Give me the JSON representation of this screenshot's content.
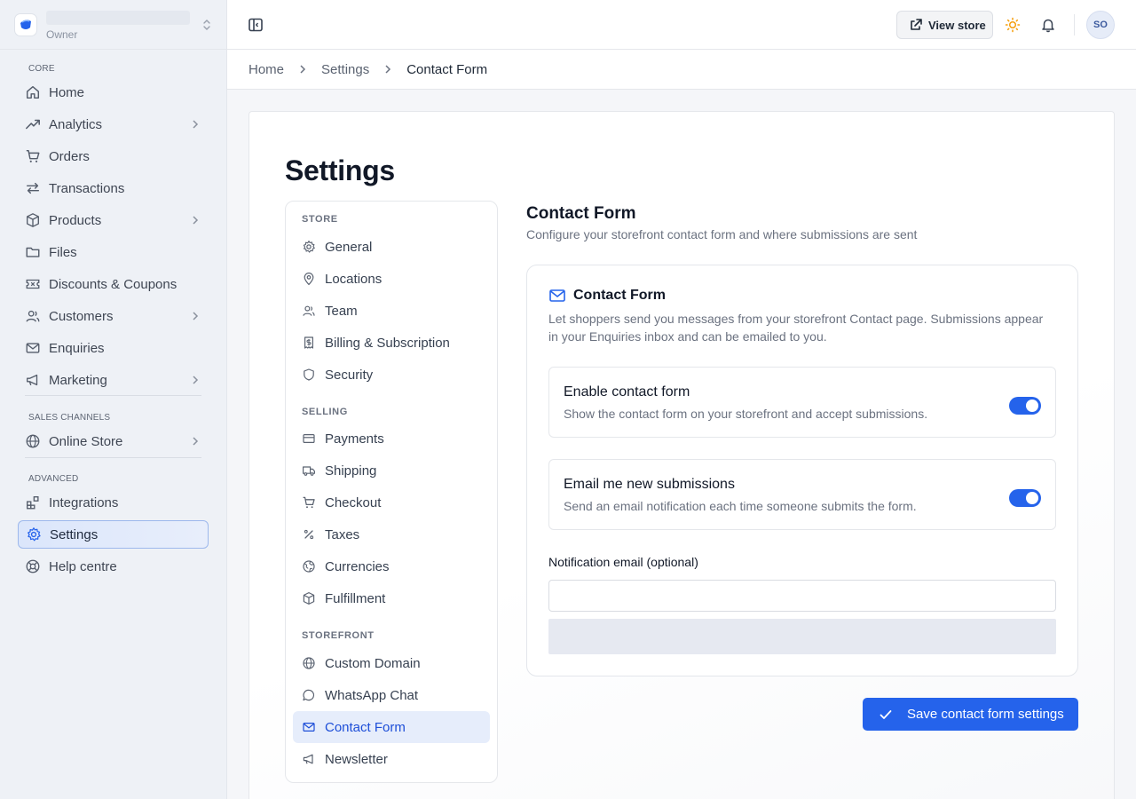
{
  "store": {
    "role": "Owner"
  },
  "sidebar": {
    "sections": [
      "CORE",
      "SALES CHANNELS",
      "ADVANCED"
    ],
    "core": [
      {
        "label": "Home",
        "icon": "home-icon",
        "chevron": false
      },
      {
        "label": "Analytics",
        "icon": "analytics-icon",
        "chevron": true
      },
      {
        "label": "Orders",
        "icon": "cart-icon",
        "chevron": false
      },
      {
        "label": "Transactions",
        "icon": "transfer-icon",
        "chevron": false
      },
      {
        "label": "Products",
        "icon": "box-icon",
        "chevron": true
      },
      {
        "label": "Files",
        "icon": "folder-icon",
        "chevron": false
      },
      {
        "label": "Discounts & Coupons",
        "icon": "ticket-icon",
        "chevron": false
      },
      {
        "label": "Customers",
        "icon": "users-icon",
        "chevron": true
      },
      {
        "label": "Enquiries",
        "icon": "mail-icon",
        "chevron": false
      },
      {
        "label": "Marketing",
        "icon": "megaphone-icon",
        "chevron": true
      }
    ],
    "sales": [
      {
        "label": "Online Store",
        "icon": "globe-icon",
        "chevron": true
      }
    ],
    "advanced": [
      {
        "label": "Integrations",
        "icon": "blocks-icon",
        "chevron": false
      },
      {
        "label": "Settings",
        "icon": "gear-icon",
        "chevron": false,
        "active": true
      },
      {
        "label": "Help centre",
        "icon": "lifebuoy-icon",
        "chevron": false
      }
    ]
  },
  "topbar": {
    "view_store": "View store",
    "avatar": "SO"
  },
  "breadcrumb": [
    "Home",
    "Settings",
    "Contact Form"
  ],
  "page_title": "Settings",
  "settings_nav": {
    "store_label": "STORE",
    "store": [
      {
        "label": "General",
        "icon": "gear-icon"
      },
      {
        "label": "Locations",
        "icon": "map-pin-icon"
      },
      {
        "label": "Team",
        "icon": "users-icon"
      },
      {
        "label": "Billing & Subscription",
        "icon": "receipt-icon"
      },
      {
        "label": "Security",
        "icon": "shield-icon"
      }
    ],
    "selling_label": "SELLING",
    "selling": [
      {
        "label": "Payments",
        "icon": "credit-card-icon"
      },
      {
        "label": "Shipping",
        "icon": "truck-icon"
      },
      {
        "label": "Checkout",
        "icon": "cart-icon"
      },
      {
        "label": "Taxes",
        "icon": "percent-icon"
      },
      {
        "label": "Currencies",
        "icon": "currency-globe-icon"
      },
      {
        "label": "Fulfillment",
        "icon": "box-icon"
      }
    ],
    "storefront_label": "STOREFRONT",
    "storefront": [
      {
        "label": "Custom Domain",
        "icon": "globe-icon"
      },
      {
        "label": "WhatsApp Chat",
        "icon": "chat-icon"
      },
      {
        "label": "Contact Form",
        "icon": "mail-icon",
        "active": true
      },
      {
        "label": "Newsletter",
        "icon": "megaphone-icon"
      }
    ]
  },
  "content": {
    "title": "Contact Form",
    "subtitle": "Configure your storefront contact form and where submissions are sent",
    "card_title": "Contact Form",
    "card_desc": "Let shoppers send you messages from your storefront Contact page. Submissions appear in your Enquiries inbox and can be emailed to you.",
    "toggles": [
      {
        "title": "Enable contact form",
        "desc": "Show the contact form on your storefront and accept submissions.",
        "on": true
      },
      {
        "title": "Email me new submissions",
        "desc": "Send an email notification each time someone submits the form.",
        "on": true
      }
    ],
    "email_label": "Notification email (optional)",
    "email_value": "",
    "save_label": "Save contact form settings"
  },
  "colors": {
    "accent": "#2563eb",
    "sun": "#f59e0b"
  }
}
